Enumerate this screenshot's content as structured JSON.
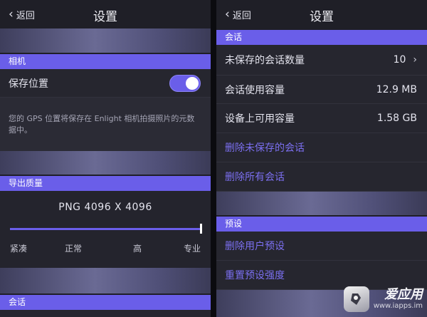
{
  "colors": {
    "accent": "#6a5ee9",
    "action_text": "#7b6ff0",
    "row_bg": "#26262f"
  },
  "left": {
    "nav": {
      "back_label": "返回",
      "title": "设置",
      "back_icon": "chevron-left-icon"
    },
    "camera": {
      "header": "相机",
      "save_location_label": "保存位置",
      "save_location_on": true,
      "gps_note": "您的 GPS 位置将保存在 Enlight 相机拍摄照片的元数据中。"
    },
    "export": {
      "header": "导出质量",
      "format_label": "PNG   4096 X 4096",
      "quality_levels": [
        "紧凑",
        "正常",
        "高",
        "专业"
      ],
      "selected_level": "专业"
    },
    "session_header": "会话"
  },
  "right": {
    "nav": {
      "back_label": "返回",
      "title": "设置",
      "back_icon": "chevron-left-icon"
    },
    "session": {
      "header": "会话",
      "unsaved_count_label": "未保存的会话数量",
      "unsaved_count_value": "10",
      "usage_label": "会话使用容量",
      "usage_value": "12.9 MB",
      "available_label": "设备上可用容量",
      "available_value": "1.58 GB",
      "delete_unsaved": "删除未保存的会话",
      "delete_all": "删除所有会话"
    },
    "presets": {
      "header": "预设",
      "delete_user_presets": "删除用户预设",
      "reset_strength": "重置预设强度"
    }
  },
  "watermark": {
    "name": "爱应用",
    "url": "www.iapps.im",
    "icon": "iapps-logo-icon"
  }
}
